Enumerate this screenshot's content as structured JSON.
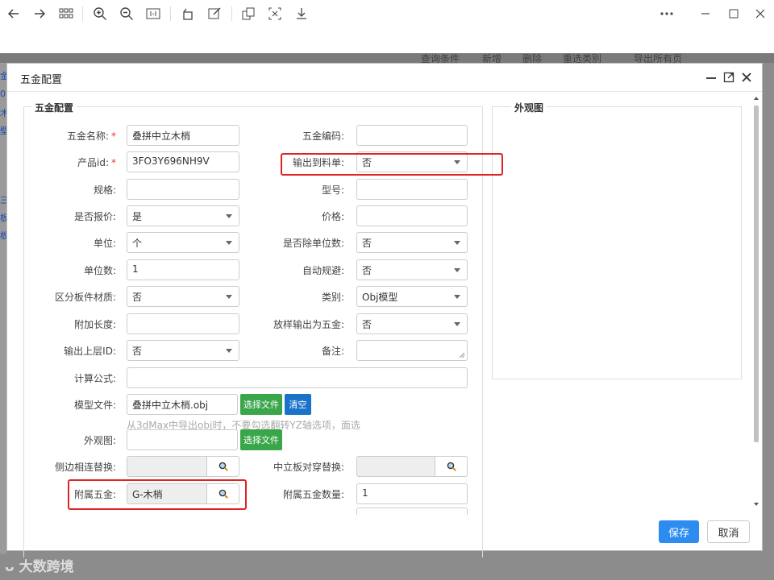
{
  "background": {
    "toolbar_items": [
      "查询条件",
      "新增",
      "删除",
      "重选类别",
      "导出所有页"
    ],
    "left_fragments": [
      "金",
      "0",
      "木",
      "壁",
      "三",
      "板",
      "板"
    ]
  },
  "modal": {
    "title": "五金配置",
    "left_legend": "五金配置",
    "right_legend": "外观图",
    "fields": {
      "name_label": "五金名称:",
      "name_value": "叠拼中立木梢",
      "code_label": "五金编码:",
      "code_value": "",
      "productid_label": "产品id:",
      "productid_value": "3FO3Y696NH9V",
      "output_label": "输出到料单:",
      "output_value": "否",
      "spec_label": "规格:",
      "model_no_label": "型号:",
      "quote_label": "是否报价:",
      "quote_value": "是",
      "price_label": "价格:",
      "unit_label": "单位:",
      "unit_value": "个",
      "divide_label": "是否除单位数:",
      "divide_value": "否",
      "unitcount_label": "单位数:",
      "unitcount_value": "1",
      "auto_avoid_label": "自动规避:",
      "auto_avoid_value": "否",
      "material_label": "区分板件材质:",
      "material_value": "否",
      "category_label": "类别:",
      "category_value": "Obj模型",
      "extra_len_label": "附加长度:",
      "sample_out_label": "放样输出为五金:",
      "sample_out_value": "否",
      "upper_id_label": "输出上层ID:",
      "upper_id_value": "否",
      "remark_label": "备注:",
      "formula_label": "计算公式:",
      "model_file_label": "模型文件:",
      "model_file_value": "叠拼中立木梢.obj",
      "choose_file_btn": "选择文件",
      "clear_btn": "清空",
      "hint_text": "从3dMax中导出obj时，不要勾选翻转YZ轴选项，面选",
      "appearance_label": "外观图:",
      "choose_file_btn2": "选择文件",
      "side_replace_label": "侧边相连替换:",
      "middle_replace_label": "中立板对穿替换:",
      "attached_label": "附属五金:",
      "attached_value": "G-木梢",
      "attached_qty_label": "附属五金数量:",
      "attached_qty_value": "1"
    },
    "footer": {
      "save": "保存",
      "cancel": "取消"
    }
  },
  "watermark": "大数跨境"
}
